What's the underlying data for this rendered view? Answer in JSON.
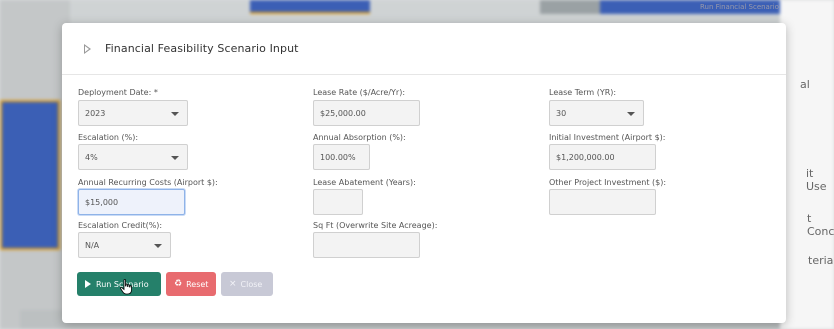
{
  "background": {
    "side_labels": [
      "al",
      "it Use",
      "t Conc",
      "terials"
    ],
    "top_label": "Run Financial Scenario"
  },
  "modal": {
    "title": "Financial Feasibility Scenario Input",
    "fields": {
      "deployment_date": {
        "label": "Deployment Date: *",
        "value": "2023"
      },
      "lease_rate": {
        "label": "Lease Rate ($/Acre/Yr):",
        "value": "$25,000.00"
      },
      "lease_term": {
        "label": "Lease Term (YR):",
        "value": "30"
      },
      "escalation": {
        "label": "Escalation (%):",
        "value": "4%"
      },
      "annual_absorption": {
        "label": "Annual Absorption (%):",
        "value": "100.00%"
      },
      "initial_investment": {
        "label": "Initial Investment (Airport $):",
        "value": "$1,200,000.00"
      },
      "annual_recurring_costs": {
        "label": "Annual Recurring Costs (Airport $):",
        "value": "$15,000"
      },
      "lease_abatement": {
        "label": "Lease Abatement (Years):",
        "value": ""
      },
      "other_project_investment": {
        "label": "Other Project Investment ($):",
        "value": ""
      },
      "escalation_credit": {
        "label": "Escalation Credit(%):",
        "value": "N/A"
      },
      "sq_ft": {
        "label": "Sq Ft (Overwrite Site Acreage):",
        "value": ""
      }
    },
    "buttons": {
      "run": "Run Scenario",
      "reset": "Reset",
      "close": "Close"
    }
  }
}
